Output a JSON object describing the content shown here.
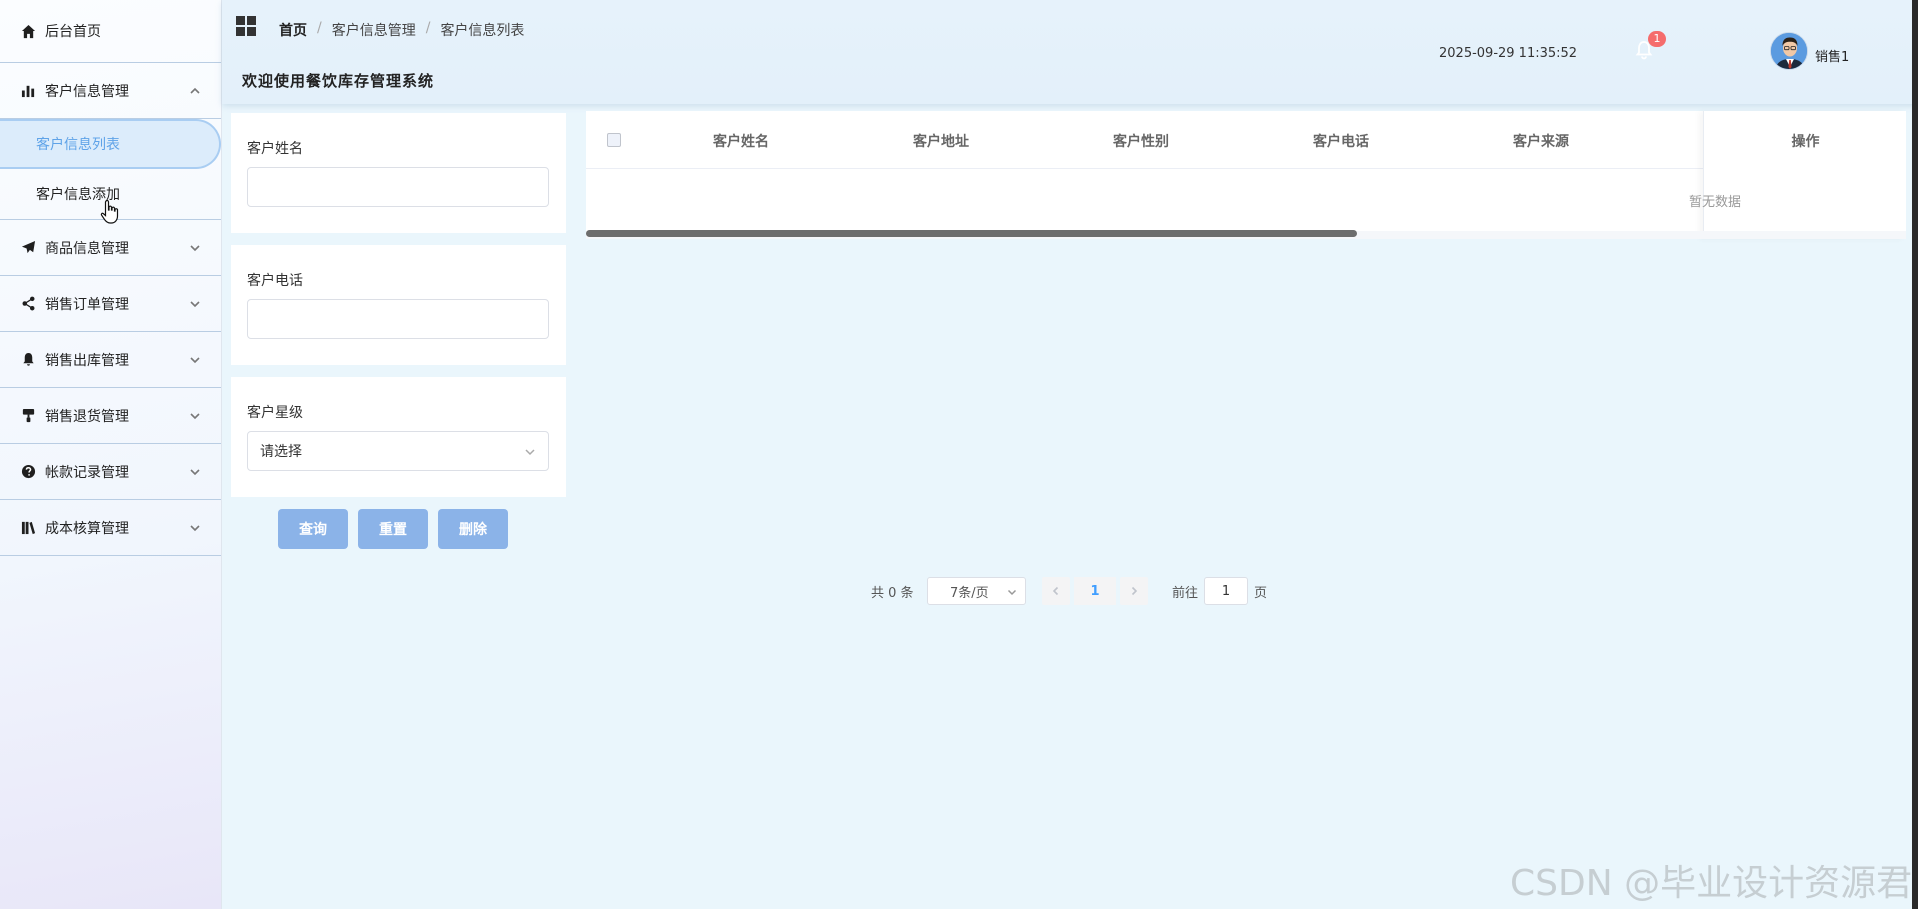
{
  "sidebar": {
    "items": [
      {
        "label": "后台首页",
        "icon": "home-icon"
      },
      {
        "label": "客户信息管理",
        "icon": "bar-chart-icon",
        "expanded": true,
        "children": [
          {
            "label": "客户信息列表",
            "active": true
          },
          {
            "label": "客户信息添加",
            "active": false
          }
        ]
      },
      {
        "label": "商品信息管理",
        "icon": "paper-plane-icon"
      },
      {
        "label": "销售订单管理",
        "icon": "share-icon"
      },
      {
        "label": "销售出库管理",
        "icon": "bell-icon"
      },
      {
        "label": "销售退货管理",
        "icon": "paint-roller-icon"
      },
      {
        "label": "帐款记录管理",
        "icon": "question-circle-icon"
      },
      {
        "label": "成本核算管理",
        "icon": "books-icon"
      }
    ]
  },
  "header": {
    "breadcrumb": [
      "首页",
      "客户信息管理",
      "客户信息列表"
    ],
    "breadcrumb_separator": "/",
    "welcome": "欢迎使用餐饮库存管理系统",
    "datetime": "2025-09-29 11:35:52",
    "notification_count": "1",
    "username": "销售1"
  },
  "filters": {
    "name_label": "客户姓名",
    "name_value": "",
    "phone_label": "客户电话",
    "phone_value": "",
    "level_label": "客户星级",
    "level_placeholder": "请选择"
  },
  "buttons": {
    "query": "查询",
    "reset": "重置",
    "delete": "删除"
  },
  "table": {
    "columns": [
      "客户姓名",
      "客户地址",
      "客户性别",
      "客户电话",
      "客户来源"
    ],
    "action_column": "操作",
    "rows": [],
    "empty_text": "暂无数据"
  },
  "pagination": {
    "total_text": "共 0 条",
    "page_size": "7条/页",
    "current_page": "1",
    "goto_prefix": "前往",
    "goto_value": "1",
    "goto_suffix": "页"
  },
  "watermark": "CSDN @毕业设计资源君",
  "colors": {
    "accent": "#409eff",
    "button": "#8bb3e8",
    "badge": "#f56c6c",
    "active_menu_text": "#5fa3e8"
  }
}
